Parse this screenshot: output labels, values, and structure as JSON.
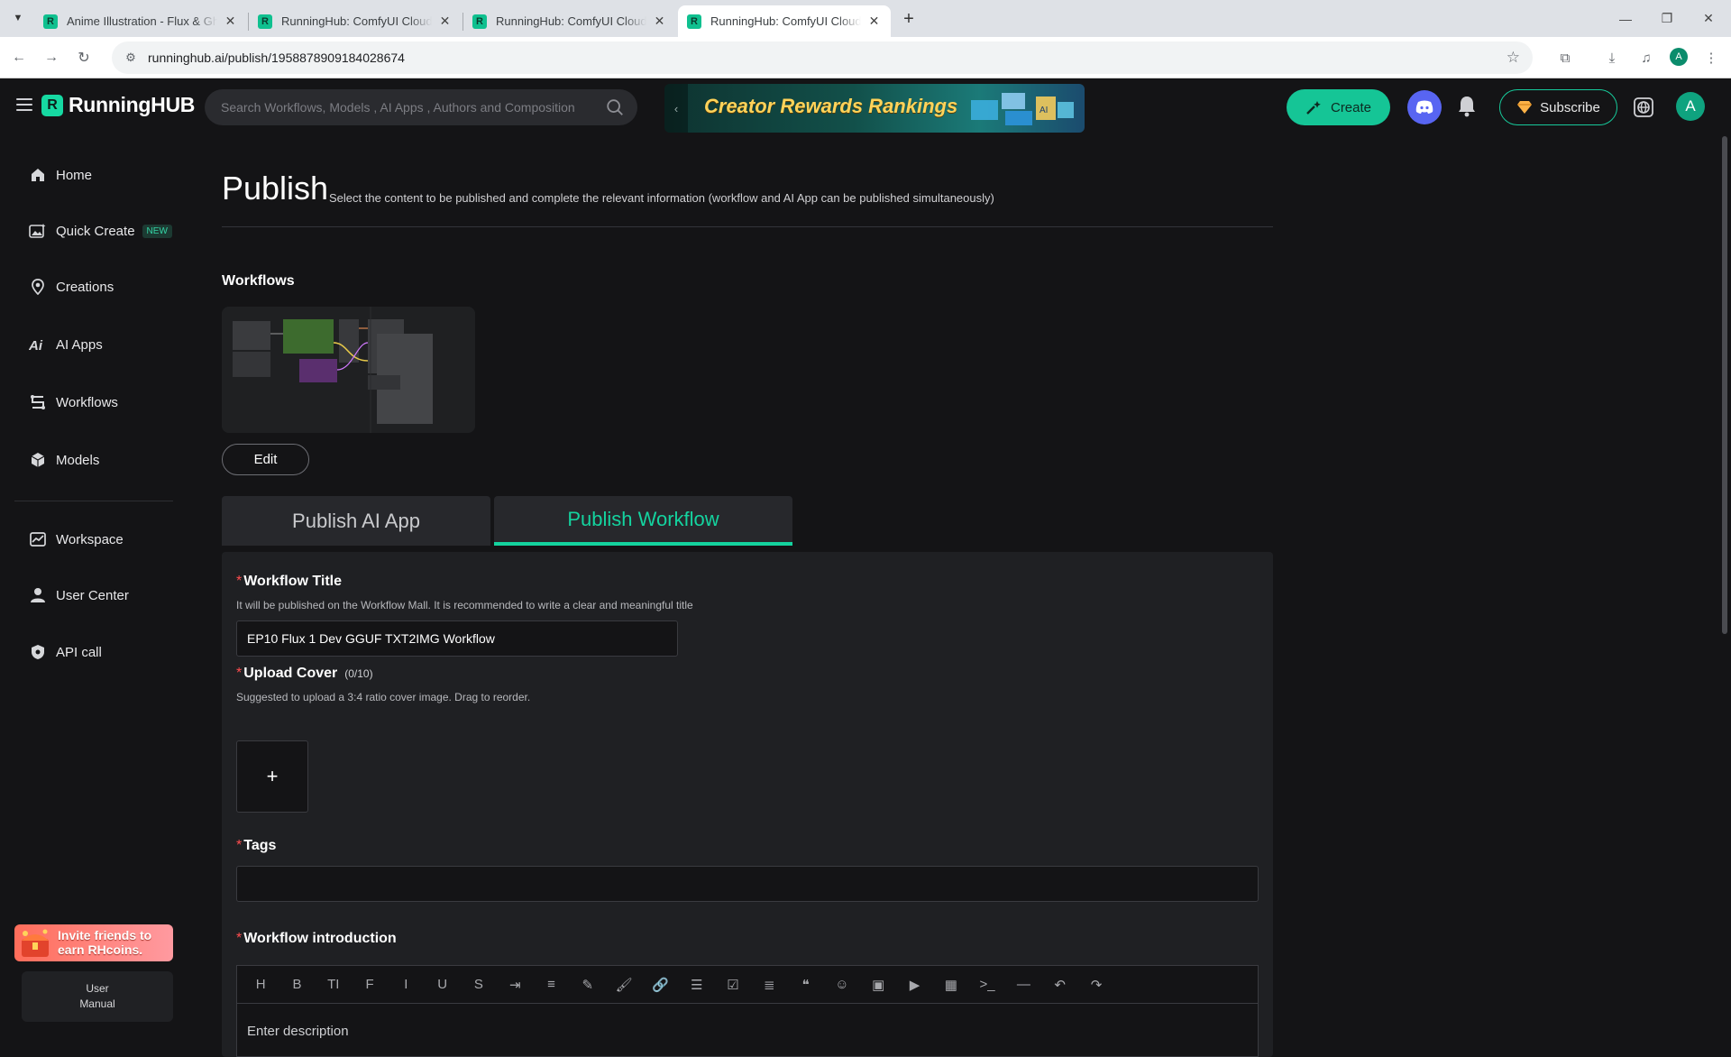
{
  "browser": {
    "tabs": [
      {
        "title": "Anime Illustration - Flux & Ghibli"
      },
      {
        "title": "RunningHub: ComfyUI Cloud, C"
      },
      {
        "title": "RunningHub: ComfyUI Cloud, C"
      },
      {
        "title": "RunningHub: ComfyUI Cloud, C"
      }
    ],
    "active_tab": 3,
    "url": "runninghub.ai/publish/1958878909184028674",
    "profile_initial": "A"
  },
  "header": {
    "logo_text": "RunningHUB",
    "search_placeholder": "Search Workflows, Models , AI Apps , Authors and Composition",
    "banner_text": "Creator Rewards Rankings",
    "create_label": "Create",
    "subscribe_label": "Subscribe",
    "avatar_initial": "A",
    "accent_color": "#15c596"
  },
  "sidebar": {
    "items": [
      {
        "label": "Home",
        "icon": "home-icon"
      },
      {
        "label": "Quick Create",
        "icon": "quick-create-icon",
        "badge": "NEW"
      },
      {
        "label": "Creations",
        "icon": "creations-icon"
      },
      {
        "label": "AI Apps",
        "icon": "ai-apps-icon"
      },
      {
        "label": "Workflows",
        "icon": "workflows-icon"
      },
      {
        "label": "Models",
        "icon": "models-icon"
      },
      {
        "label": "Workspace",
        "icon": "workspace-icon"
      },
      {
        "label": "User Center",
        "icon": "user-icon"
      },
      {
        "label": "API call",
        "icon": "api-icon"
      }
    ],
    "invite_text": "Invite friends to earn RHcoins.",
    "manual_text": "User\nManual"
  },
  "main": {
    "title": "Publish",
    "subtitle": "Select the content to be published and complete the relevant information (workflow and AI App can be published simultaneously)",
    "workflows_label": "Workflows",
    "edit_label": "Edit",
    "tabs": [
      {
        "label": "Publish AI App",
        "active": false
      },
      {
        "label": "Publish Workflow",
        "active": true
      }
    ],
    "form": {
      "title_label": "Workflow Title",
      "title_hint": "It will be published on the Workflow Mall. It is recommended to write a clear and meaningful title",
      "title_value": "EP10 Flux 1 Dev GGUF TXT2IMG Workflow",
      "cover_label": "Upload Cover",
      "cover_count": "(0/10)",
      "cover_hint": "Suggested to upload a 3:4 ratio cover image. Drag to reorder.",
      "upload_symbol": "+",
      "tags_label": "Tags",
      "tags_value": "",
      "intro_label": "Workflow introduction",
      "intro_placeholder": "Enter description",
      "toolbar": [
        {
          "name": "heading-icon",
          "glyph": "H"
        },
        {
          "name": "bold-icon",
          "glyph": "B"
        },
        {
          "name": "font-size-icon",
          "glyph": "TI"
        },
        {
          "name": "font-family-icon",
          "glyph": "F"
        },
        {
          "name": "italic-icon",
          "glyph": "I"
        },
        {
          "name": "underline-icon",
          "glyph": "U"
        },
        {
          "name": "strikethrough-icon",
          "glyph": "S"
        },
        {
          "name": "indent-icon",
          "glyph": "⇥"
        },
        {
          "name": "line-height-icon",
          "glyph": "≡"
        },
        {
          "name": "font-color-icon",
          "glyph": "✎"
        },
        {
          "name": "background-color-icon",
          "glyph": "🖌"
        },
        {
          "name": "link-icon",
          "glyph": "🔗"
        },
        {
          "name": "bullet-list-icon",
          "glyph": "☰"
        },
        {
          "name": "todo-icon",
          "glyph": "☑"
        },
        {
          "name": "align-icon",
          "glyph": "≣"
        },
        {
          "name": "quote-icon",
          "glyph": "❝"
        },
        {
          "name": "emoji-icon",
          "glyph": "☺"
        },
        {
          "name": "image-icon",
          "glyph": "▣"
        },
        {
          "name": "video-icon",
          "glyph": "▶"
        },
        {
          "name": "table-icon",
          "glyph": "▦"
        },
        {
          "name": "code-icon",
          "glyph": ">_"
        },
        {
          "name": "divider-icon",
          "glyph": "—"
        },
        {
          "name": "undo-icon",
          "glyph": "↶"
        },
        {
          "name": "redo-icon",
          "glyph": "↷"
        }
      ]
    }
  }
}
